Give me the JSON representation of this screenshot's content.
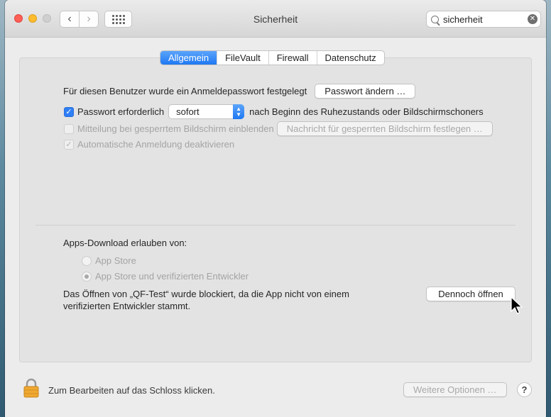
{
  "window": {
    "title": "Sicherheit"
  },
  "search": {
    "value": "sicherheit"
  },
  "tabs": [
    "Allgemein",
    "FileVault",
    "Firewall",
    "Datenschutz"
  ],
  "general": {
    "password_set_text": "Für diesen Benutzer wurde ein Anmeldepasswort festgelegt",
    "change_password_button": "Passwort ändern …",
    "require_password_label": "Passwort erforderlich",
    "require_password_value": "sofort",
    "require_password_suffix": "nach Beginn des Ruhezustands oder Bildschirmschoners",
    "lock_message_label": "Mitteilung bei gesperrtem Bildschirm einblenden",
    "lock_message_button": "Nachricht für gesperrten Bildschirm festlegen …",
    "auto_login_label": "Automatische Anmeldung deaktivieren"
  },
  "downloads": {
    "heading": "Apps-Download erlauben von:",
    "options": [
      "App Store",
      "App Store und verifizierten Entwickler"
    ],
    "blocked_line1": "Das Öffnen von „QF-Test“ wurde blockiert, da die App nicht von einem",
    "blocked_line2": "verifizierten Entwickler stammt.",
    "open_anyway_button": "Dennoch öffnen"
  },
  "footer": {
    "lock_text": "Zum Bearbeiten auf das Schloss klicken.",
    "advanced_button": "Weitere Optionen …",
    "help_label": "?"
  },
  "colors": {
    "accent": "#1f78f2",
    "window_bg": "#ececec"
  }
}
